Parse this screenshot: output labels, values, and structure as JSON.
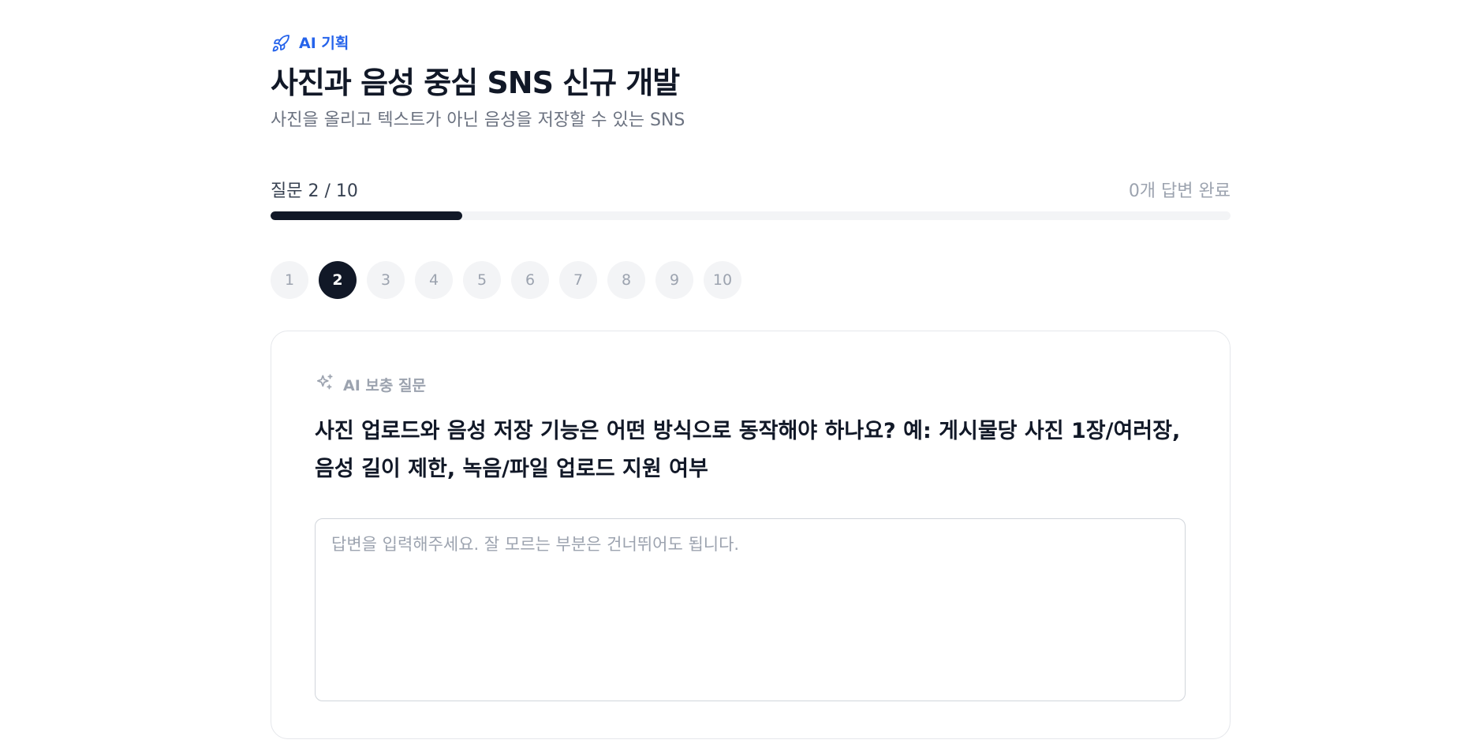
{
  "header": {
    "eyebrow_icon": "rocket-icon",
    "eyebrow_label": "AI 기획",
    "title": "사진과 음성 중심 SNS 신규 개발",
    "subtitle": "사진을 올리고 텍스트가 아닌 음성을 저장할 수 있는 SNS"
  },
  "progress": {
    "label": "질문 2 / 10",
    "answered": "0개 답변 완료",
    "value": 0.2
  },
  "steps": [
    "1",
    "2",
    "3",
    "4",
    "5",
    "6",
    "7",
    "8",
    "9",
    "10"
  ],
  "active_step": 2,
  "card": {
    "tag_icon": "sparkles-icon",
    "tag_label": "AI 보충 질문",
    "question": "사진 업로드와 음성 저장 기능은 어떤 방식으로 동작해야 하나요? 예: 게시물당 사진 1장/여러장, 음성 길이 제한, 녹음/파일 업로드 지원 여부",
    "answer_value": "",
    "answer_placeholder": "답변을 입력해주세요. 잘 모르는 부분은 건너뛰어도 됩니다."
  },
  "colors": {
    "accent": "#2563eb",
    "dark": "#111827",
    "muted": "#9ca3af",
    "track": "#f3f4f6"
  }
}
